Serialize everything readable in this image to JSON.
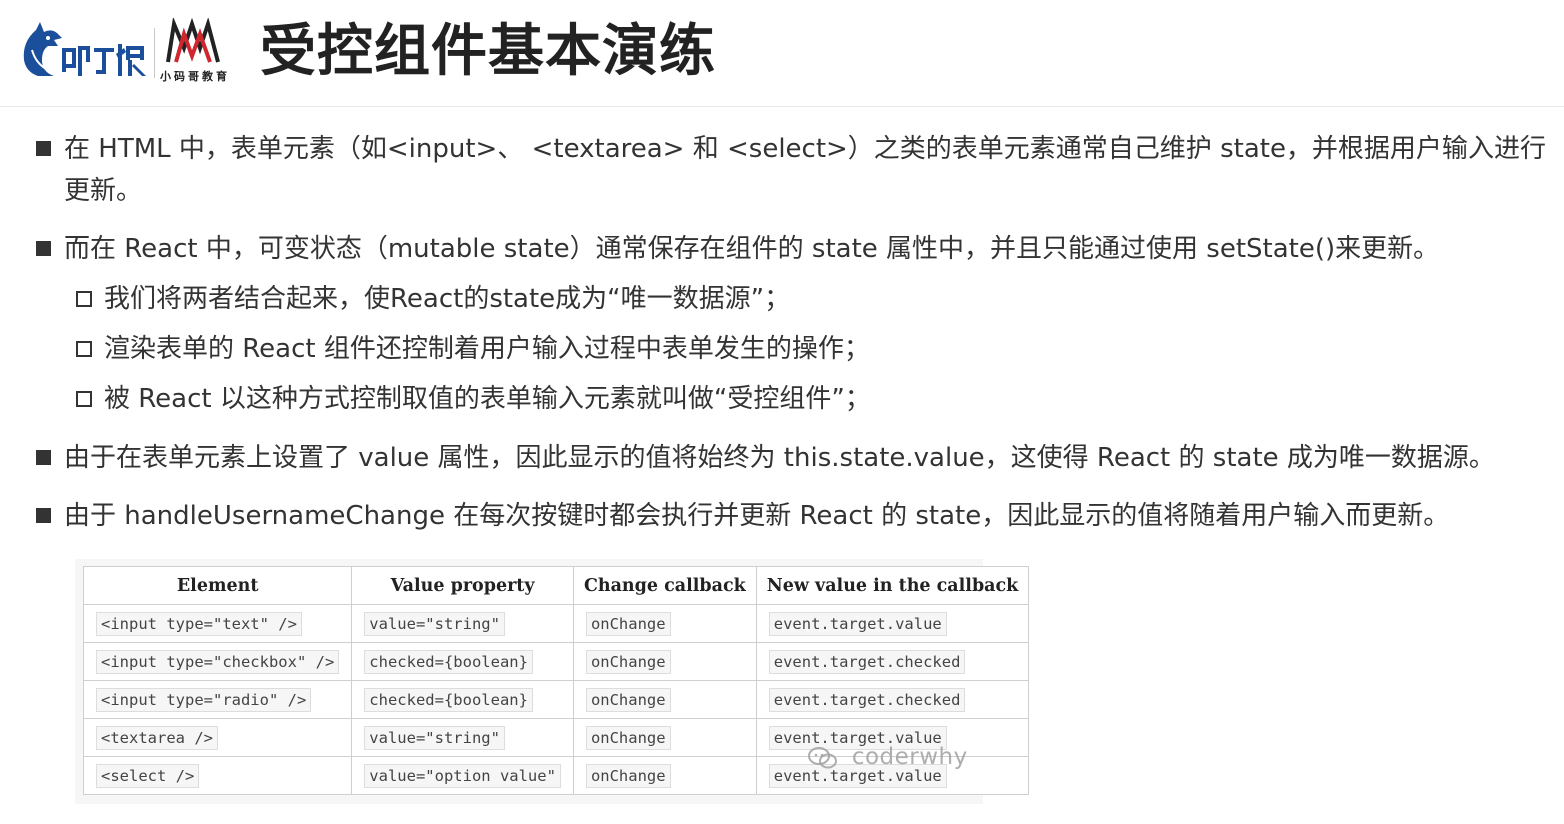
{
  "header": {
    "title": "受控组件基本演练",
    "logo_text": "叩丁狼",
    "brand_subtitle": "小码哥教育"
  },
  "bullets": [
    "在 HTML 中，表单元素（如<input>、 <textarea> 和 <select>）之类的表单元素通常自己维护 state，并根据用户输入进行更新。",
    "而在 React 中，可变状态（mutable state）通常保存在组件的 state 属性中，并且只能通过使用 setState()来更新。",
    "由于在表单元素上设置了 value 属性，因此显示的值将始终为 this.state.value，这使得 React 的 state 成为唯一数据源。",
    "由于 handleUsernameChange 在每次按键时都会执行并更新 React 的 state，因此显示的值将随着用户输入而更新。"
  ],
  "sub_bullets": [
    "我们将两者结合起来，使React的state成为“唯一数据源”；",
    "渲染表单的 React 组件还控制着用户输入过程中表单发生的操作；",
    "被 React 以这种方式控制取值的表单输入元素就叫做“受控组件”；"
  ],
  "table": {
    "headers": [
      "Element",
      "Value property",
      "Change callback",
      "New value in the callback"
    ],
    "rows": [
      [
        "<input type=\"text\" />",
        "value=\"string\"",
        "onChange",
        "event.target.value"
      ],
      [
        "<input type=\"checkbox\" />",
        "checked={boolean}",
        "onChange",
        "event.target.checked"
      ],
      [
        "<input type=\"radio\" />",
        "checked={boolean}",
        "onChange",
        "event.target.checked"
      ],
      [
        "<textarea />",
        "value=\"string\"",
        "onChange",
        "event.target.value"
      ],
      [
        "<select />",
        "value=\"option value\"",
        "onChange",
        "event.target.value"
      ]
    ]
  },
  "watermark": "coderwhy",
  "colors": {
    "logo_blue": "#1b4f9c",
    "logo_red": "#d0262e",
    "text": "#333333"
  }
}
